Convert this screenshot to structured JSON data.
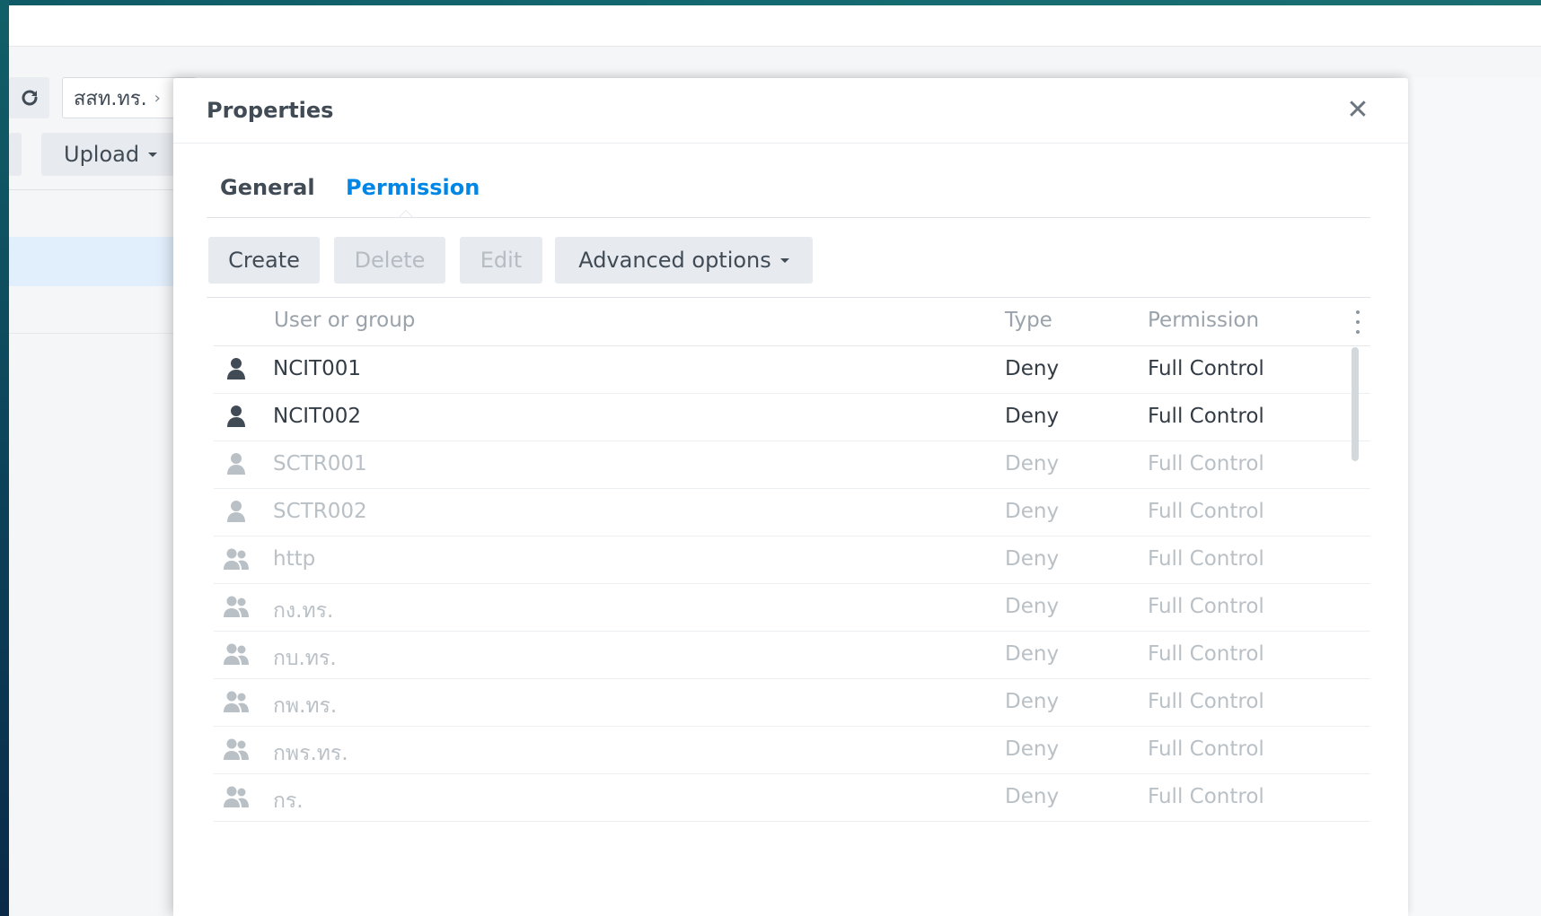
{
  "background": {
    "path_segment": "สสท.ทร.",
    "path_chevron": "›",
    "upload_label": "Upload"
  },
  "dialog": {
    "title": "Properties",
    "close_glyph": "✕",
    "tabs": {
      "general": "General",
      "permission": "Permission"
    },
    "toolbar": {
      "create": "Create",
      "delete": "Delete",
      "edit": "Edit",
      "advanced": "Advanced options"
    },
    "table": {
      "columns": {
        "user": "User or group",
        "type": "Type",
        "permission": "Permission"
      },
      "rows": [
        {
          "kind": "user",
          "name": "NCIT001",
          "type": "Deny",
          "permission": "Full Control",
          "state": "active"
        },
        {
          "kind": "user",
          "name": "NCIT002",
          "type": "Deny",
          "permission": "Full Control",
          "state": "active"
        },
        {
          "kind": "user",
          "name": "SCTR001",
          "type": "Deny",
          "permission": "Full Control",
          "state": "muted"
        },
        {
          "kind": "user",
          "name": "SCTR002",
          "type": "Deny",
          "permission": "Full Control",
          "state": "muted"
        },
        {
          "kind": "group",
          "name": "http",
          "type": "Deny",
          "permission": "Full Control",
          "state": "muted"
        },
        {
          "kind": "group",
          "name": "กง.ทร.",
          "type": "Deny",
          "permission": "Full Control",
          "state": "muted"
        },
        {
          "kind": "group",
          "name": "กบ.ทร.",
          "type": "Deny",
          "permission": "Full Control",
          "state": "muted"
        },
        {
          "kind": "group",
          "name": "กพ.ทร.",
          "type": "Deny",
          "permission": "Full Control",
          "state": "muted"
        },
        {
          "kind": "group",
          "name": "กพร.ทร.",
          "type": "Deny",
          "permission": "Full Control",
          "state": "muted"
        },
        {
          "kind": "group",
          "name": "กร.",
          "type": "Deny",
          "permission": "Full Control",
          "state": "muted"
        }
      ]
    }
  },
  "colors": {
    "accent": "#0086e5",
    "frame": "#0f4a58",
    "text": "#414b55",
    "muted_text": "#b9c0c6",
    "selected_row": "#e1eefb"
  }
}
